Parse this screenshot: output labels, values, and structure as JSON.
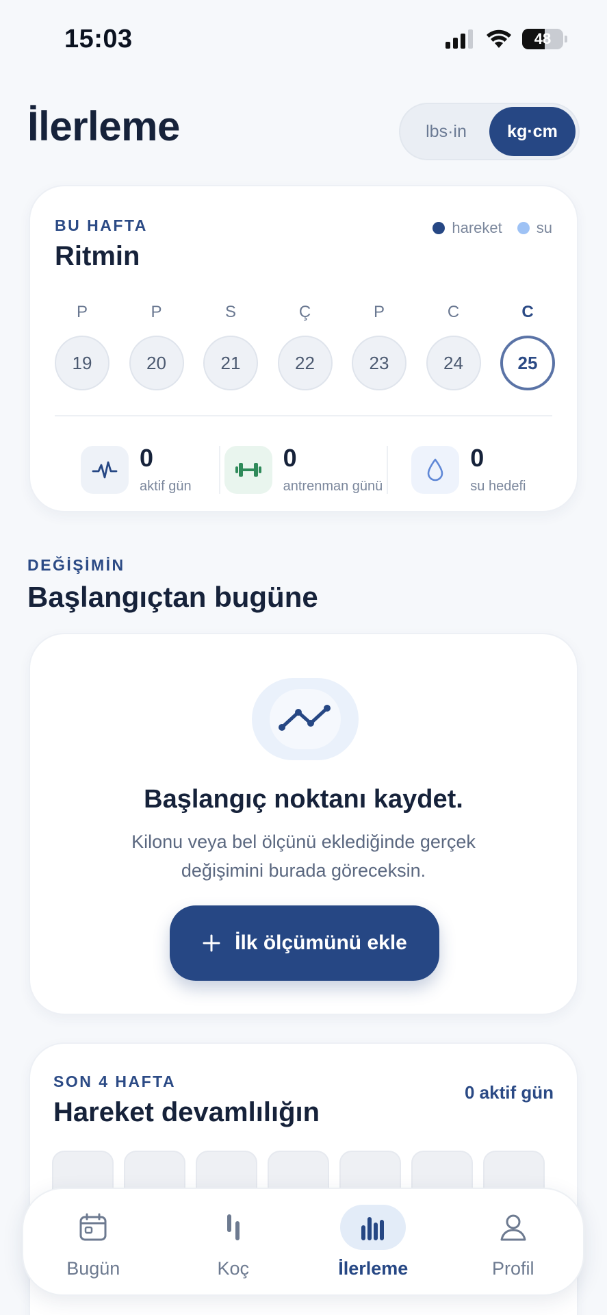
{
  "status_bar": {
    "time": "15:03",
    "battery": "48"
  },
  "header": {
    "title": "İlerleme",
    "unit_toggle": {
      "imperial": "lbs·in",
      "metric": "kg·cm"
    }
  },
  "week": {
    "eyebrow": "BU HAFTA",
    "title": "Ritmin",
    "legend": [
      {
        "label": "hareket",
        "color": "#264784"
      },
      {
        "label": "su",
        "color": "#9ec2f5"
      }
    ],
    "days": [
      {
        "letter": "P",
        "date": "19"
      },
      {
        "letter": "P",
        "date": "20"
      },
      {
        "letter": "S",
        "date": "21"
      },
      {
        "letter": "Ç",
        "date": "22"
      },
      {
        "letter": "P",
        "date": "23"
      },
      {
        "letter": "C",
        "date": "24"
      },
      {
        "letter": "C",
        "date": "25"
      }
    ],
    "stats": [
      {
        "value": "0",
        "label": "aktif gün",
        "icon": "activity-icon"
      },
      {
        "value": "0",
        "label": "antrenman günü",
        "icon": "dumbbell-icon"
      },
      {
        "value": "0",
        "label": "su hedefi",
        "icon": "water-drop-icon"
      }
    ]
  },
  "change": {
    "eyebrow": "DEĞİŞİMİN",
    "title": "Başlangıçtan bugüne",
    "empty_title": "Başlangıç noktanı kaydet.",
    "empty_desc": "Kilonu veya bel ölçünü eklediğinde gerçek değişimini burada göreceksin.",
    "button_label": "İlk ölçümünü ekle"
  },
  "streak": {
    "eyebrow": "SON 4 HAFTA",
    "title": "Hareket devamlılığın",
    "count": "0 aktif gün"
  },
  "tabs": [
    {
      "label": "Bugün",
      "icon": "calendar-icon"
    },
    {
      "label": "Koç",
      "icon": "coach-icon"
    },
    {
      "label": "İlerleme",
      "icon": "bar-chart-icon"
    },
    {
      "label": "Profil",
      "icon": "profile-icon"
    }
  ],
  "colors": {
    "primary": "#264784",
    "background": "#f6f8fb",
    "water": "#9ec2f5",
    "green": "#2f8a5a"
  }
}
